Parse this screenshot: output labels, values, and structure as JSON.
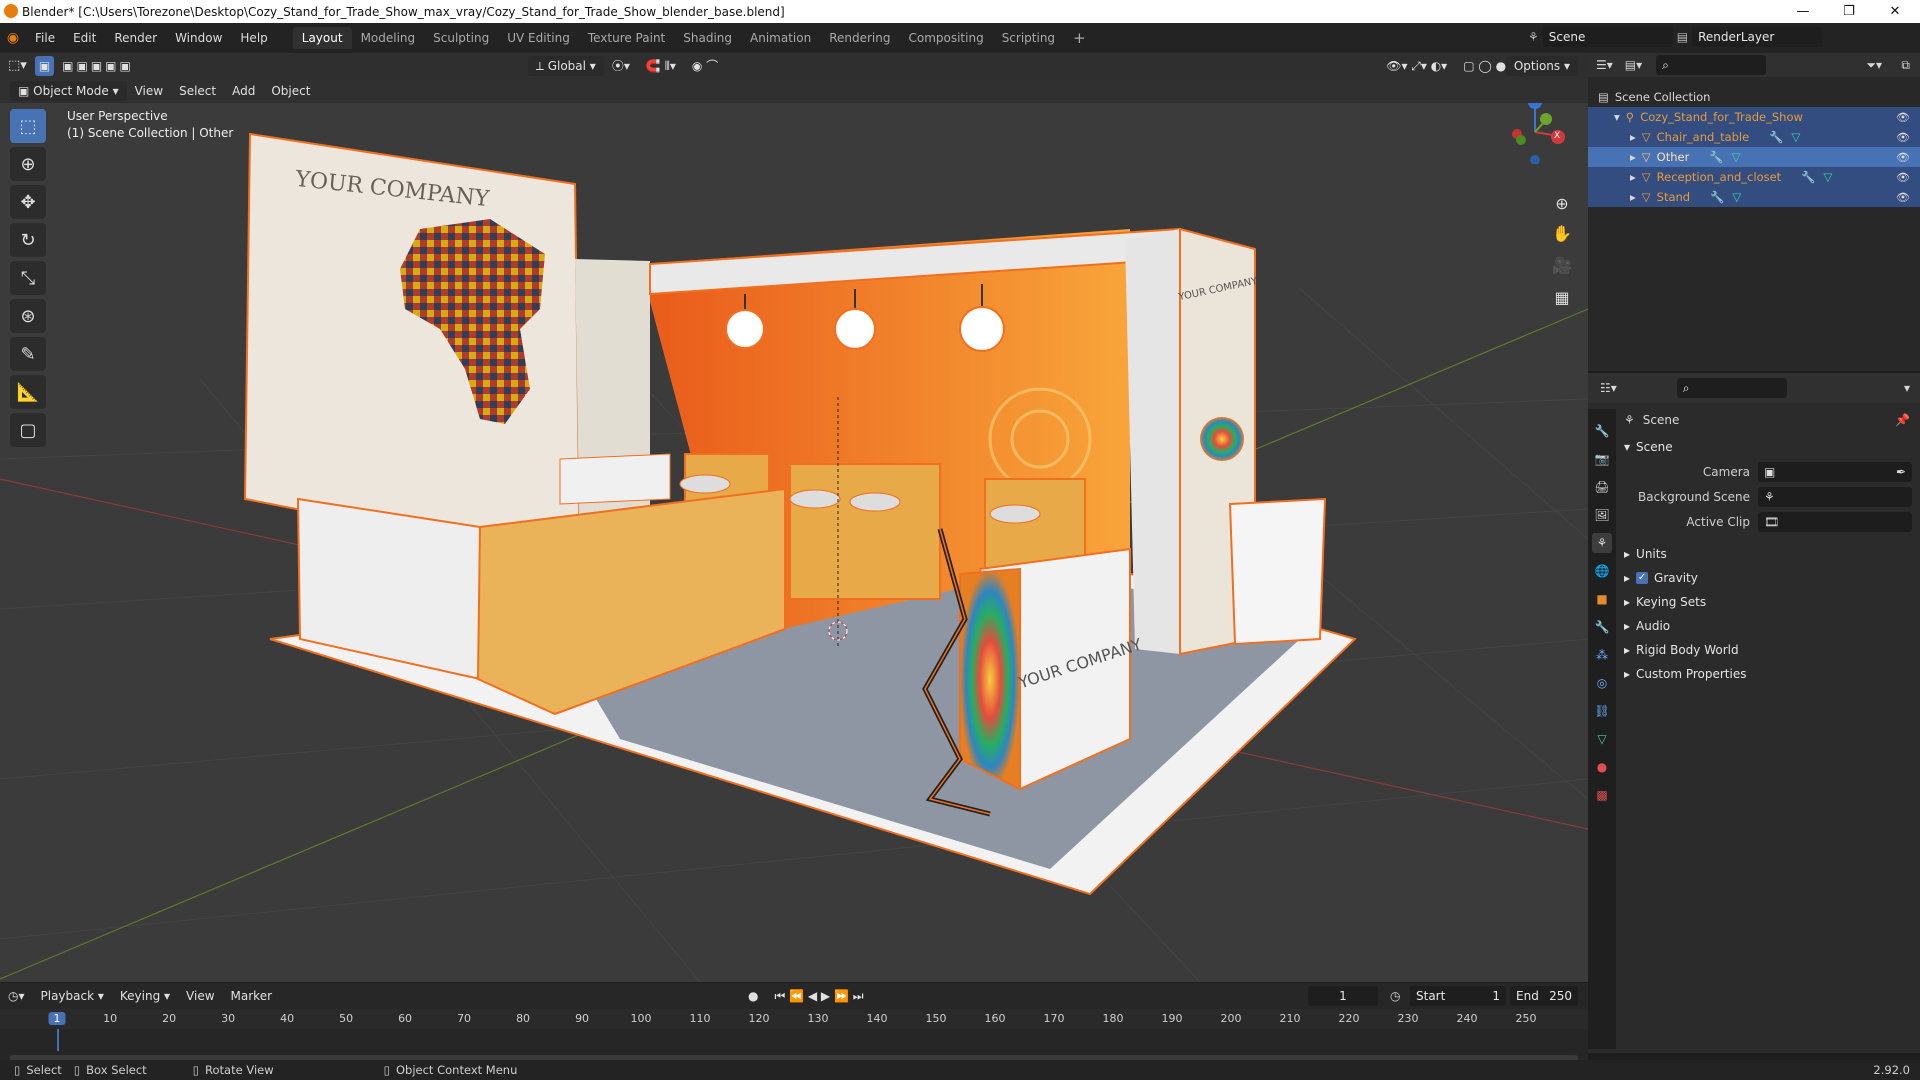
{
  "window": {
    "title": "Blender* [C:\\Users\\Torezone\\Desktop\\Cozy_Stand_for_Trade_Show_max_vray/Cozy_Stand_for_Trade_Show_blender_base.blend]",
    "minimize": "—",
    "maximize": "❐",
    "close": "✕"
  },
  "menu": [
    "File",
    "Edit",
    "Render",
    "Window",
    "Help"
  ],
  "workspaces": [
    "Layout",
    "Modeling",
    "Sculpting",
    "UV Editing",
    "Texture Paint",
    "Shading",
    "Animation",
    "Rendering",
    "Compositing",
    "Scripting"
  ],
  "scene_name": "Scene",
  "render_layer": "RenderLayer",
  "viewport": {
    "mode": "Object Mode",
    "menus": [
      "View",
      "Select",
      "Add",
      "Object"
    ],
    "transform": "Global",
    "options": "Options",
    "overlay_title": "User Perspective",
    "overlay_sub": "(1) Scene Collection | Other",
    "booth_text_1": "YOUR COMPANY",
    "booth_text_2": "YOUR COMPANY",
    "booth_text_3": "YOUR COMPANY",
    "gizmo": {
      "z": "Z",
      "y": "Y",
      "x": "X"
    }
  },
  "outliner": {
    "root": "Scene Collection",
    "collection": "Cozy_Stand_for_Trade_Show",
    "items": [
      "Chair_and_table",
      "Other",
      "Reception_and_closet",
      "Stand"
    ]
  },
  "properties": {
    "title": "Scene",
    "section": "Scene",
    "fields": [
      {
        "label": "Camera",
        "value": ""
      },
      {
        "label": "Background Scene",
        "value": ""
      },
      {
        "label": "Active Clip",
        "value": ""
      }
    ],
    "panels": [
      "Units",
      "Gravity",
      "Keying Sets",
      "Audio",
      "Rigid Body World",
      "Custom Properties"
    ]
  },
  "timeline": {
    "menus": [
      "Playback",
      "Keying",
      "View",
      "Marker"
    ],
    "current": "1",
    "start_label": "Start",
    "start": "1",
    "end_label": "End",
    "end": "250",
    "ticks": [
      "1",
      "10",
      "20",
      "30",
      "40",
      "50",
      "60",
      "70",
      "80",
      "90",
      "100",
      "110",
      "120",
      "130",
      "140",
      "150",
      "160",
      "170",
      "180",
      "190",
      "200",
      "210",
      "220",
      "230",
      "240",
      "250"
    ]
  },
  "status": {
    "select": "Select",
    "box": "Box Select",
    "rotate": "Rotate View",
    "context": "Object Context Menu",
    "version": "2.92.0"
  }
}
